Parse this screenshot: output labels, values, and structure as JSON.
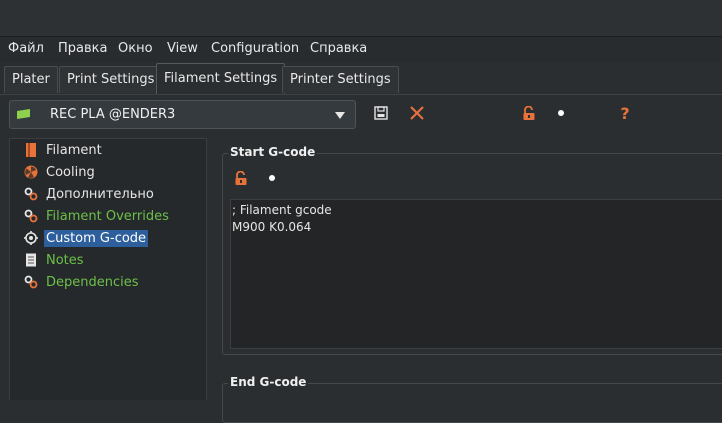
{
  "menu": {
    "items": [
      {
        "label": "Файл"
      },
      {
        "label": "Правка"
      },
      {
        "label": "Окно"
      },
      {
        "label": "View"
      },
      {
        "label": "Configuration"
      },
      {
        "label": "Справка"
      }
    ]
  },
  "tabs": [
    {
      "label": "Plater"
    },
    {
      "label": "Print Settings"
    },
    {
      "label": "Filament Settings",
      "active": true
    },
    {
      "label": "Printer Settings"
    }
  ],
  "preset": {
    "selected": "REC PLA @ENDER3",
    "flag_color": "#8fd14f"
  },
  "toolbar": {
    "save_icon": "save-icon",
    "delete_icon": "close-icon",
    "lock_icon": "lock-open-icon",
    "dot_icon": "bullet-icon",
    "help_icon": "question-icon",
    "accent_color": "#e8733a"
  },
  "tree": {
    "items": [
      {
        "label": "Filament",
        "icon": "filament-icon",
        "style": "normal"
      },
      {
        "label": "Cooling",
        "icon": "cooling-icon",
        "style": "normal"
      },
      {
        "label": "Дополнительно",
        "icon": "wrench-icon",
        "style": "normal"
      },
      {
        "label": "Filament Overrides",
        "icon": "wrench-icon",
        "style": "green"
      },
      {
        "label": "Custom G-code",
        "icon": "gcode-icon",
        "style": "selected"
      },
      {
        "label": "Notes",
        "icon": "notes-icon",
        "style": "green"
      },
      {
        "label": "Dependencies",
        "icon": "wrench-icon",
        "style": "green"
      }
    ]
  },
  "start_gcode": {
    "title": "Start G-code",
    "lines": "; Filament gcode\nM900 K0.064"
  },
  "end_gcode": {
    "title": "End G-code"
  }
}
